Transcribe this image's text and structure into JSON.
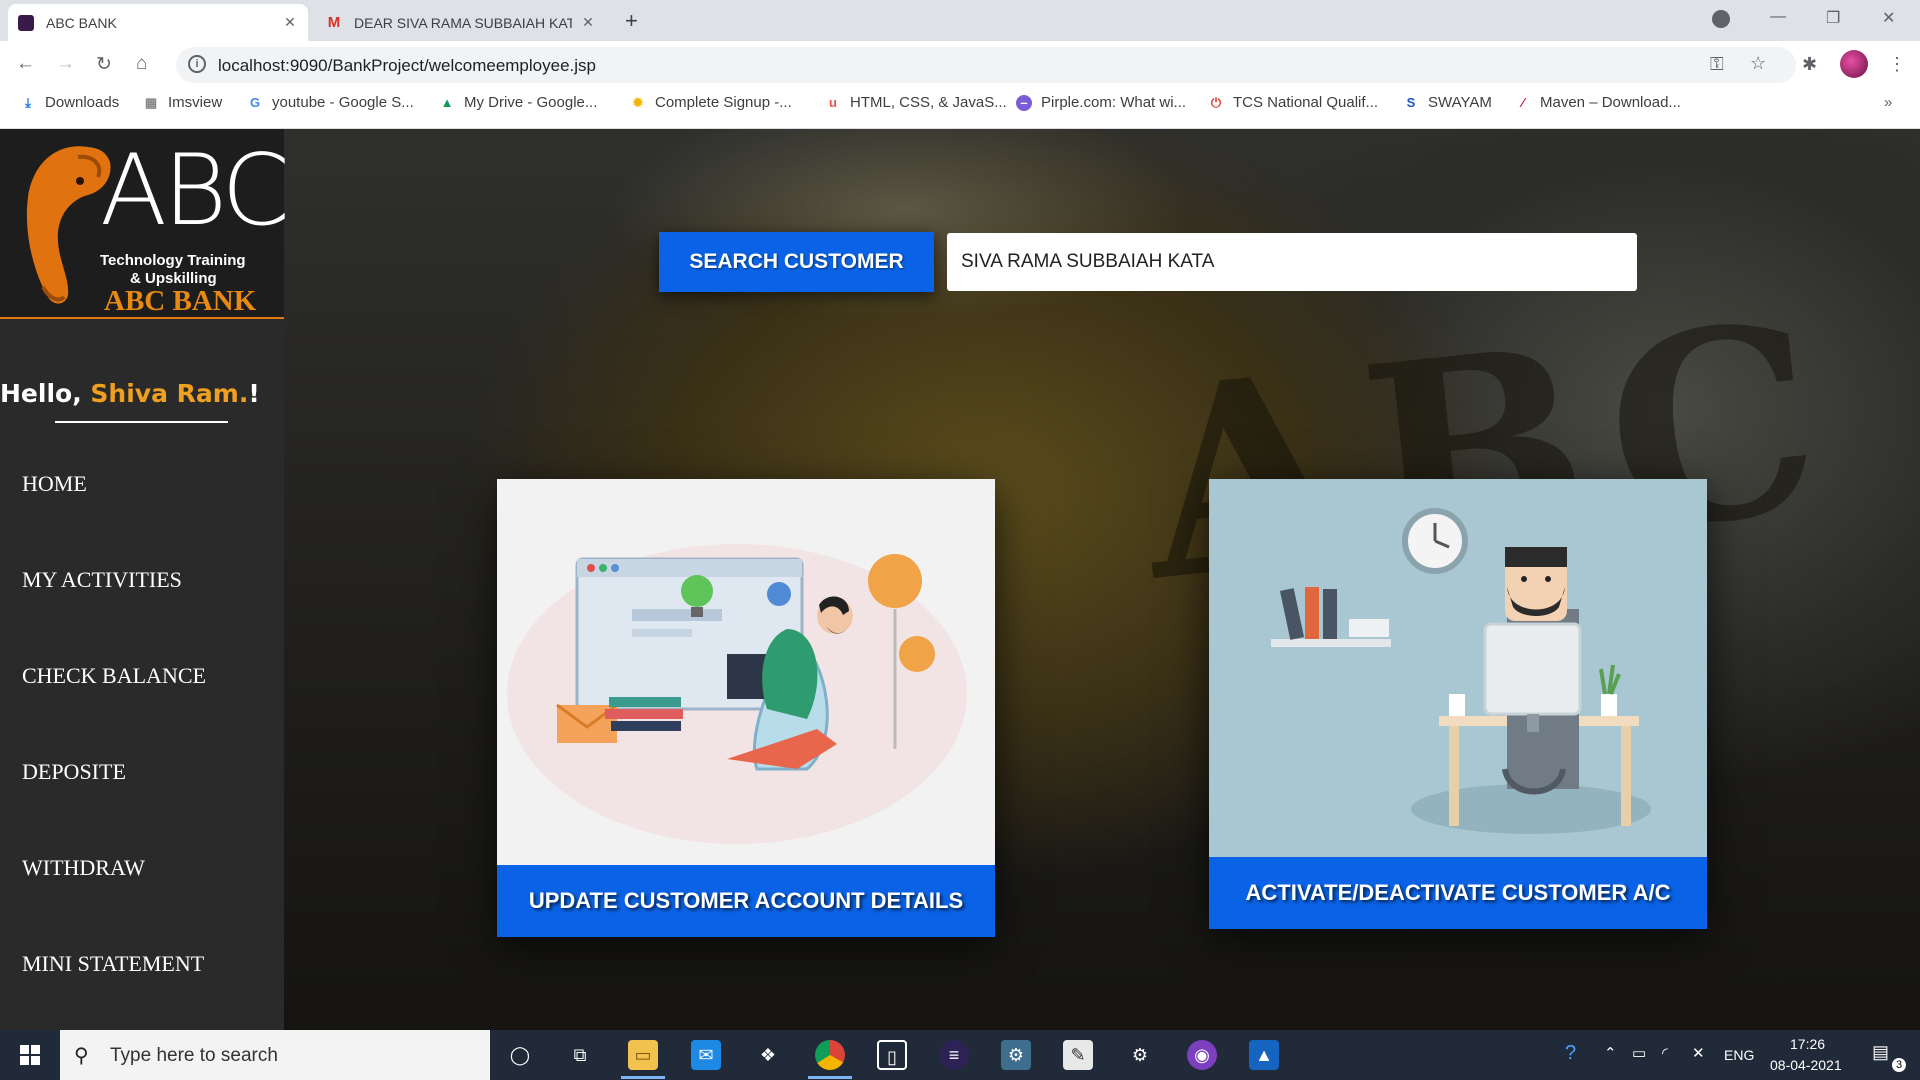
{
  "browser": {
    "tabs": [
      {
        "title": "ABC BANK",
        "active": true
      },
      {
        "title": "DEAR SIVA RAMA SUBBAIAH KATA",
        "active": false
      }
    ],
    "url": "localhost:9090/BankProject/welcomeemployee.jsp",
    "bookmarks": [
      {
        "label": "Downloads",
        "icon": "download-icon"
      },
      {
        "label": "Imsview",
        "icon": "grid-icon"
      },
      {
        "label": "youtube - Google S...",
        "icon": "google-icon"
      },
      {
        "label": "My Drive - Google...",
        "icon": "drive-icon"
      },
      {
        "label": "Complete Signup -...",
        "icon": "sun-icon"
      },
      {
        "label": "HTML, CSS, & JavaS...",
        "icon": "udemy-icon"
      },
      {
        "label": "Pirple.com: What wi...",
        "icon": "pirple-icon"
      },
      {
        "label": "TCS National Qualif...",
        "icon": "power-icon"
      },
      {
        "label": "SWAYAM",
        "icon": "swayam-icon"
      },
      {
        "label": "Maven – Download...",
        "icon": "feather-icon"
      }
    ]
  },
  "sidebar": {
    "logo": {
      "abc": "ABC",
      "line1": "Technology Training",
      "line2": "& Upskilling",
      "bank": "ABC BANK"
    },
    "greeting": {
      "hello": "Hello, ",
      "name": "Shiva Ram.",
      "suffix": "!"
    },
    "nav": [
      {
        "label": "HOME"
      },
      {
        "label": "MY ACTIVITIES"
      },
      {
        "label": "CHECK BALANCE"
      },
      {
        "label": "DEPOSITE"
      },
      {
        "label": "WITHDRAW"
      },
      {
        "label": "MINI STATEMENT"
      }
    ]
  },
  "main": {
    "search_button": "SEARCH CUSTOMER",
    "search_value": "SIVA RAMA SUBBAIAH KATA",
    "cards": [
      {
        "caption": "UPDATE CUSTOMER ACCOUNT DETAILS"
      },
      {
        "caption": "ACTIVATE/DEACTIVATE CUSTOMER A/C"
      }
    ]
  },
  "taskbar": {
    "search_placeholder": "Type here to search",
    "language": "ENG",
    "time": "17:26",
    "date": "08-04-2021",
    "notifications": "3"
  },
  "colors": {
    "accent": "#0a63e6",
    "brand_orange": "#e88a12",
    "sidebar": "#2a2a2a"
  }
}
